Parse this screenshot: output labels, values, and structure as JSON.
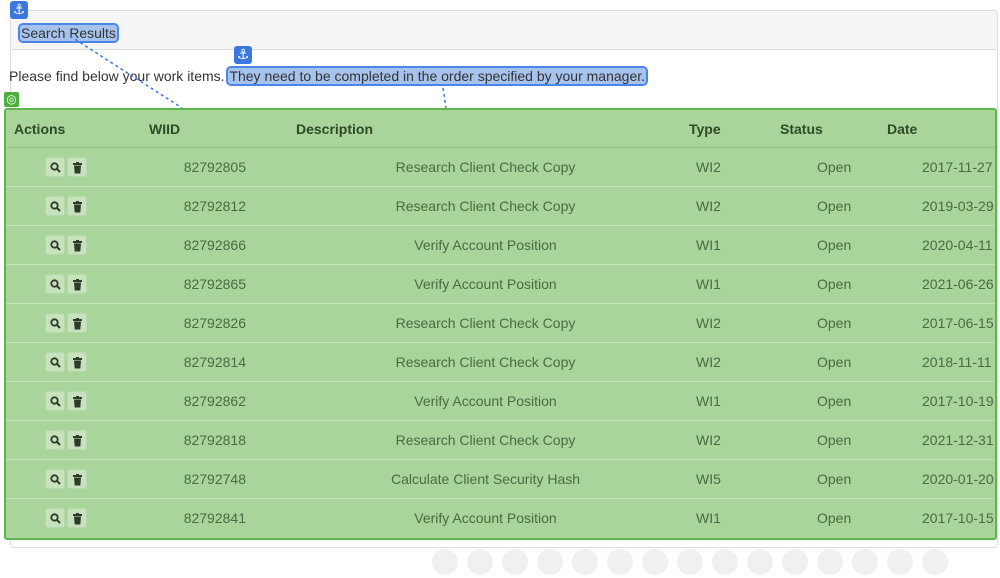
{
  "panel": {
    "title": "Search Results",
    "intro_prefix": "Please find below your work items.",
    "intro_highlight": "They need to be completed in the order specified by your manager."
  },
  "badges": {
    "anchor_icon": "⚓",
    "target_icon": "◎"
  },
  "table": {
    "headers": [
      "Actions",
      "WIID",
      "Description",
      "Type",
      "Status",
      "Date"
    ],
    "rows": [
      {
        "wiid": "82792805",
        "description": "Research Client Check Copy",
        "type": "WI2",
        "status": "Open",
        "date": "2017-11-27"
      },
      {
        "wiid": "82792812",
        "description": "Research Client Check Copy",
        "type": "WI2",
        "status": "Open",
        "date": "2019-03-29"
      },
      {
        "wiid": "82792866",
        "description": "Verify Account Position",
        "type": "WI1",
        "status": "Open",
        "date": "2020-04-11"
      },
      {
        "wiid": "82792865",
        "description": "Verify Account Position",
        "type": "WI1",
        "status": "Open",
        "date": "2021-06-26"
      },
      {
        "wiid": "82792826",
        "description": "Research Client Check Copy",
        "type": "WI2",
        "status": "Open",
        "date": "2017-06-15"
      },
      {
        "wiid": "82792814",
        "description": "Research Client Check Copy",
        "type": "WI2",
        "status": "Open",
        "date": "2018-11-11"
      },
      {
        "wiid": "82792862",
        "description": "Verify Account Position",
        "type": "WI1",
        "status": "Open",
        "date": "2017-10-19"
      },
      {
        "wiid": "82792818",
        "description": "Research Client Check Copy",
        "type": "WI2",
        "status": "Open",
        "date": "2021-12-31"
      },
      {
        "wiid": "82792748",
        "description": "Calculate Client Security Hash",
        "type": "WI5",
        "status": "Open",
        "date": "2020-01-20"
      },
      {
        "wiid": "82792841",
        "description": "Verify Account Position",
        "type": "WI1",
        "status": "Open",
        "date": "2017-10-15"
      }
    ]
  },
  "colors": {
    "anchor_highlight": "#4a86e8",
    "target_overlay": "#a9d59a",
    "target_border": "#5cb84c"
  }
}
